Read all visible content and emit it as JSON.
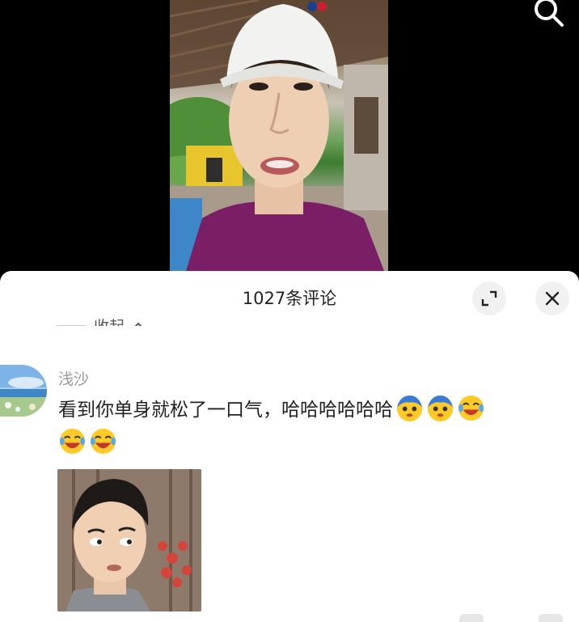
{
  "video": {
    "description_icon": "search-icon"
  },
  "sheet": {
    "title": "1027条评论",
    "expand_icon": "expand-icon",
    "close_icon": "close-icon",
    "collapse_label": "收起"
  },
  "comment": {
    "username": "浅沙",
    "text": "看到你单身就松了一口气，哈哈哈哈哈哈",
    "emojis_line1": [
      "shy-emoji",
      "shy-emoji",
      "laugh-cry-emoji"
    ],
    "emojis_line2": [
      "laugh-cry-emoji",
      "laugh-cry-emoji"
    ],
    "attached_image": "meme-image"
  },
  "colors": {
    "sheet_bg": "#ffffff",
    "title_text": "#222222",
    "username_text": "#999999",
    "button_bg": "#f1f1f1"
  }
}
